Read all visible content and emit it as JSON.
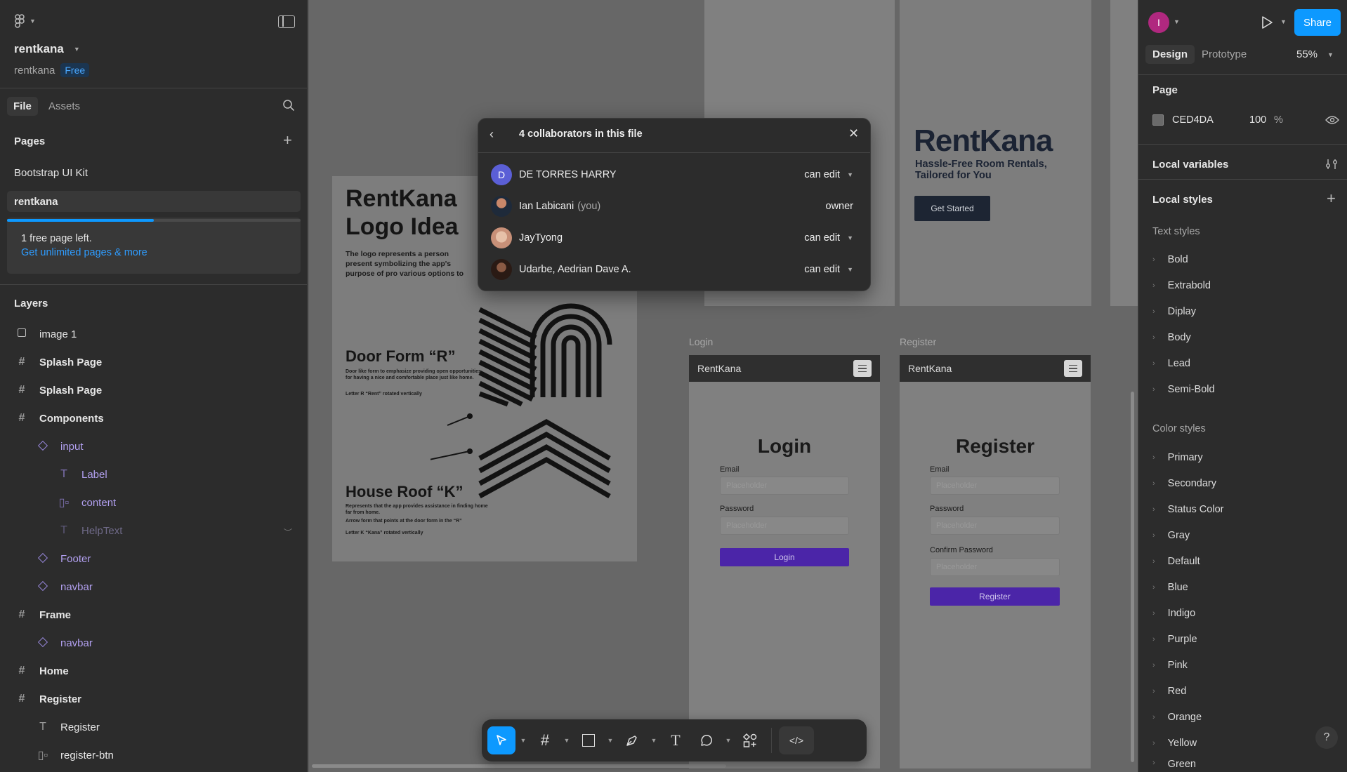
{
  "left": {
    "project_name": "rentkana",
    "team_name": "rentkana",
    "plan_badge": "Free",
    "tabs": [
      "File",
      "Assets"
    ],
    "pages_title": "Pages",
    "pages": [
      "Bootstrap UI Kit",
      "rentkana"
    ],
    "page_limit_text": "1 free page left.",
    "page_limit_progress": 0.5,
    "upgrade_link": "Get unlimited pages & more",
    "layers_title": "Layers",
    "layers": {
      "l0": "image 1",
      "l1": "Splash Page",
      "l2": "Splash Page",
      "l3": "Components",
      "l4": "input",
      "l5": "Label",
      "l6": "content",
      "l7": "HelpText",
      "l8": "Footer",
      "l9": "navbar",
      "l10": "Frame",
      "l11": "navbar",
      "l12": "Home",
      "l13": "Register",
      "l14": "Register",
      "l15": "register-btn"
    }
  },
  "canvas": {
    "logo_frame": {
      "title": "RentKana Logo Idea",
      "title_l1": "RentKana",
      "title_l2": "Logo Idea",
      "desc": "The logo represents a person present symbolizing the app's purpose of pro various options to find a boarding ho",
      "door_title": "Door Form “R”",
      "door_desc": "Door like form to emphasize providing open opportunities for having a nice and comfortable place just like home.",
      "door_note": "Letter R “Rent” rotated vertically",
      "roof_title": "House Roof “K”",
      "roof_desc": "Represents that the app provides assistance in finding home far from home.",
      "roof_desc2": "Arrow form that points at the door form in the “R”",
      "roof_note": "Letter K “Kana” rotated vertically"
    },
    "hero": {
      "brand": "RentKana",
      "tagline_l1": "Hassle-Free Room Rentals,",
      "tagline_l2": "Tailored for You",
      "cta": "Get Started"
    },
    "login": {
      "frame_label": "Login",
      "nav_brand": "RentKana",
      "heading": "Login",
      "email_label": "Email",
      "email_placeholder": "Placeholder",
      "password_label": "Password",
      "password_placeholder": "Placeholder",
      "button": "Login"
    },
    "register": {
      "frame_label": "Register",
      "nav_brand": "RentKana",
      "heading": "Register",
      "email_label": "Email",
      "email_placeholder": "Placeholder",
      "password_label": "Password",
      "password_placeholder": "Placeholder",
      "confirm_label": "Confirm Password",
      "confirm_placeholder": "Placeholder",
      "button": "Register"
    }
  },
  "dialog": {
    "title": "4 collaborators in this file",
    "collaborators": [
      {
        "initial": "D",
        "name": "DE TORRES HARRY",
        "suffix": "",
        "role": "can edit"
      },
      {
        "initial": "",
        "name": "Ian Labicani",
        "suffix": "(you)",
        "role": "owner"
      },
      {
        "initial": "",
        "name": "JayTyong",
        "suffix": "",
        "role": "can edit"
      },
      {
        "initial": "",
        "name": "Udarbe, Aedrian Dave A.",
        "suffix": "",
        "role": "can edit"
      }
    ]
  },
  "right": {
    "user_initial": "I",
    "share_label": "Share",
    "tabs": [
      "Design",
      "Prototype"
    ],
    "zoom": "55%",
    "page_title": "Page",
    "page_color": "CED4DA",
    "page_opacity": "100",
    "percent_sign": "%",
    "local_variables": "Local variables",
    "local_styles": "Local styles",
    "text_styles_title": "Text styles",
    "text_styles": [
      "Bold",
      "Extrabold",
      "Diplay",
      "Body",
      "Lead",
      "Semi-Bold"
    ],
    "color_styles_title": "Color styles",
    "color_styles": [
      "Primary",
      "Secondary",
      "Status Color",
      "Gray",
      "Default",
      "Blue",
      "Indigo",
      "Purple",
      "Pink",
      "Red",
      "Orange",
      "Yellow",
      "Green"
    ],
    "help": "?"
  },
  "colors": {
    "accent": "#0d99ff",
    "dialog_bg": "#2c2c2c",
    "canvas_dim": "#676767",
    "purple_btn": "#4b25a8"
  }
}
